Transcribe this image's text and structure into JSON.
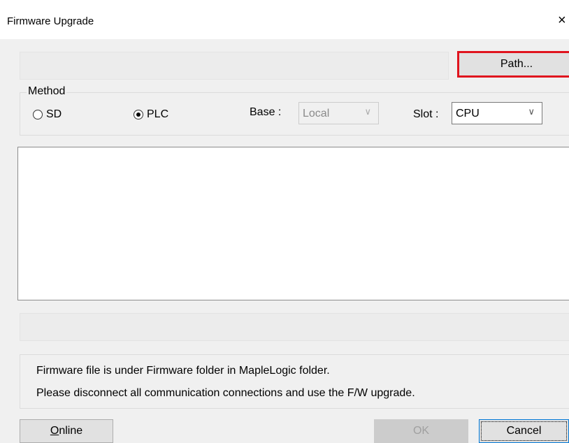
{
  "window": {
    "title": "Firmware Upgrade",
    "close_glyph": "×"
  },
  "path": {
    "value": "",
    "button_label": "Path..."
  },
  "method": {
    "legend": "Method",
    "options": [
      {
        "label": "SD",
        "checked": false
      },
      {
        "label": "PLC",
        "checked": true
      }
    ],
    "base_label": "Base :",
    "base_value": "Local",
    "slot_label": "Slot :",
    "slot_value": "CPU"
  },
  "log": {
    "lines": []
  },
  "status": {
    "text": ""
  },
  "info": {
    "line1": "Firmware file is under Firmware folder in MapleLogic folder.",
    "line2": "Please disconnect all communication connections and use the F/W upgrade."
  },
  "buttons": {
    "online_mnemonic": "O",
    "online_rest": "nline",
    "ok": "OK",
    "cancel": "Cancel"
  },
  "colors": {
    "highlight": "#e0141e",
    "titlebar": "#ffffff",
    "dialog": "#f0f0f0"
  }
}
